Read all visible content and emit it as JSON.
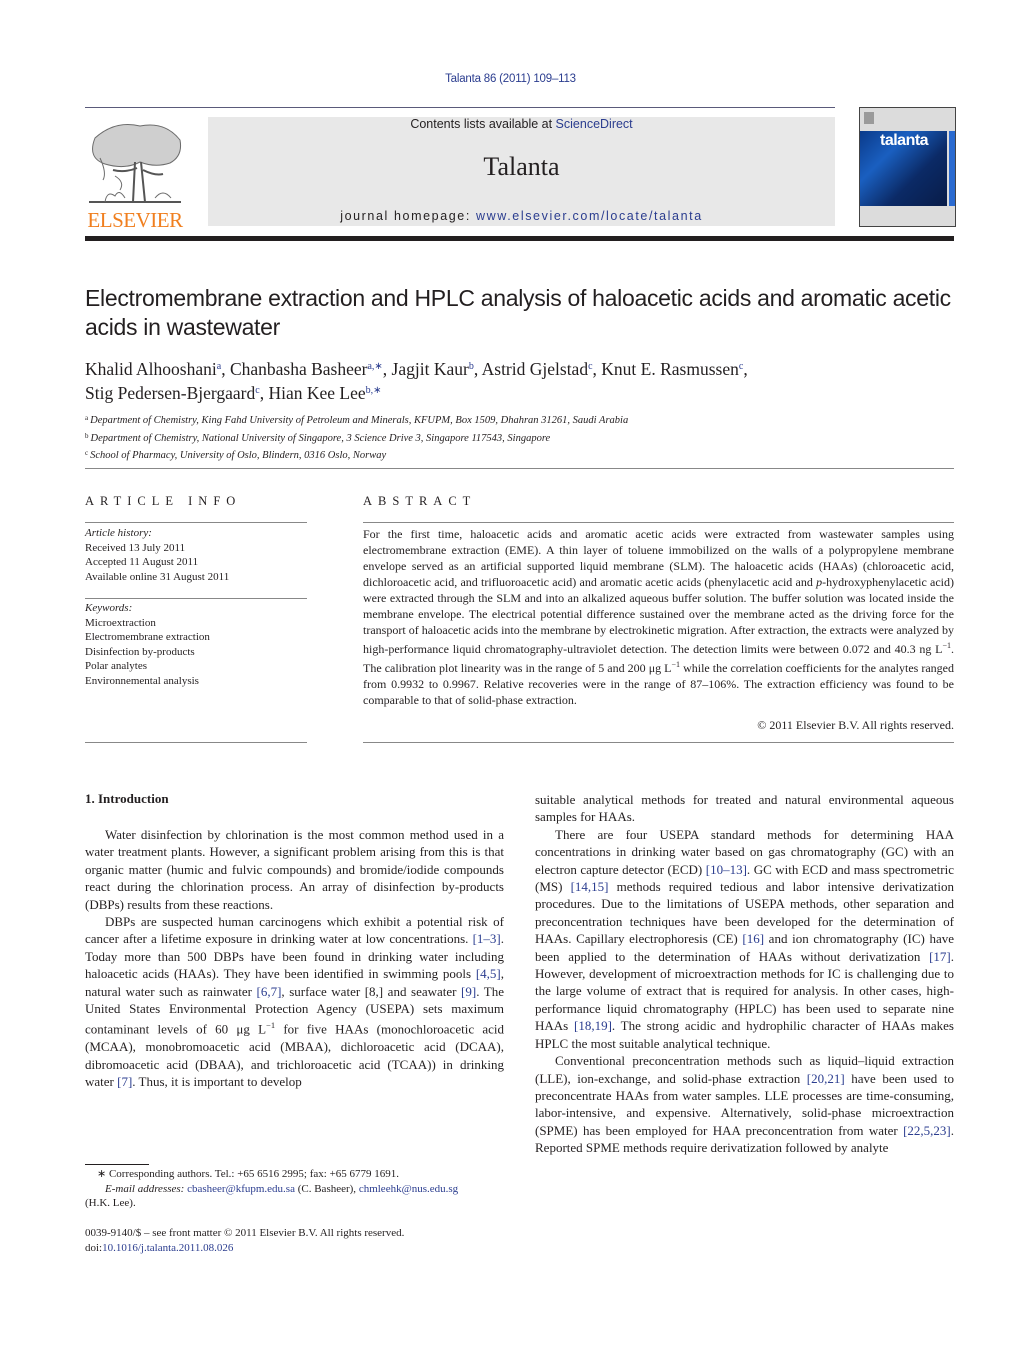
{
  "header": {
    "journal_ref": "Talanta 86 (2011) 109–113",
    "contents_prefix": "Contents lists available at ",
    "contents_link": "ScienceDirect",
    "journal_name": "Talanta",
    "homepage_prefix": "journal homepage: ",
    "homepage_link": "www.elsevier.com/locate/talanta",
    "publisher_logo": "ELSEVIER",
    "cover_title": "talanta",
    "colors": {
      "link": "#2b3d8f",
      "elsevier_orange": "#f07f1f",
      "masthead_bg": "#e8e8e8"
    }
  },
  "article": {
    "title": "Electromembrane extraction and HPLC analysis of haloacetic acids and aromatic acetic acids in wastewater",
    "authors": [
      {
        "name": "Khalid Alhooshani",
        "sup": "a"
      },
      {
        "name": "Chanbasha Basheer",
        "sup": "a,∗"
      },
      {
        "name": "Jagjit Kaur",
        "sup": "b"
      },
      {
        "name": "Astrid Gjelstad",
        "sup": "c"
      },
      {
        "name": "Knut E. Rasmussen",
        "sup": "c"
      },
      {
        "name": "Stig Pedersen-Bjergaard",
        "sup": "c"
      },
      {
        "name": "Hian Kee Lee",
        "sup": "b,∗"
      }
    ],
    "affiliations": [
      {
        "key": "a",
        "text": "Department of Chemistry, King Fahd University of Petroleum and Minerals, KFUPM, Box 1509, Dhahran 31261, Saudi Arabia"
      },
      {
        "key": "b",
        "text": "Department of Chemistry, National University of Singapore, 3 Science Drive 3, Singapore 117543, Singapore"
      },
      {
        "key": "c",
        "text": "School of Pharmacy, University of Oslo, Blindern, 0316 Oslo, Norway"
      }
    ]
  },
  "article_info": {
    "heading": "ARTICLE INFO",
    "history_label": "Article history:",
    "history": [
      "Received 13 July 2011",
      "Accepted 11 August 2011",
      "Available online 31 August 2011"
    ],
    "keywords_label": "Keywords:",
    "keywords": [
      "Microextraction",
      "Electromembrane extraction",
      "Disinfection by-products",
      "Polar analytes",
      "Environnemental analysis"
    ]
  },
  "abstract": {
    "heading": "ABSTRACT",
    "text_1": "For the first time, haloacetic acids and aromatic acetic acids were extracted from wastewater samples using electromembrane extraction (EME). A thin layer of toluene immobilized on the walls of a polypropylene membrane envelope served as an artificial supported liquid membrane (SLM). The haloacetic acids (HAAs) (chloroacetic acid, dichloroacetic acid, and trifluoroacetic acid) and aromatic acetic acids (phenylacetic acid and ",
    "text_p": "p",
    "text_2": "-hydroxyphenylacetic acid) were extracted through the SLM and into an alkalized aqueous buffer solution. The buffer solution was located inside the membrane envelope. The electrical potential difference sustained over the membrane acted as the driving force for the transport of haloacetic acids into the membrane by electrokinetic migration. After extraction, the extracts were analyzed by high-performance liquid chromatography-ultraviolet detection. The detection limits were between 0.072 and 40.3 ng L",
    "text_3": ". The calibration plot linearity was in the range of 5 and 200 μg L",
    "text_4": " while the correlation coefficients for the analytes ranged from 0.9932 to 0.9967. Relative recoveries were in the range of 87–106%. The extraction efficiency was found to be comparable to that of solid-phase extraction.",
    "sup_minus1": "−1",
    "copyright": "© 2011 Elsevier B.V. All rights reserved."
  },
  "body": {
    "section_heading": "1.  Introduction",
    "p1": "Water disinfection by chlorination is the most common method used in a water treatment plants. However, a significant problem arising from this is that organic matter (humic and fulvic compounds) and bromide/iodide compounds react during the chlorination process. An array of disinfection by-products (DBPs) results from these reactions.",
    "p2": {
      "a": "DBPs are suspected human carcinogens which exhibit a potential risk of cancer after a lifetime exposure in drinking water at low concentrations. ",
      "ref1": "[1–3]",
      "b": ". Today more than 500 DBPs have been found in drinking water including haloacetic acids (HAAs). They have been identified in swimming pools ",
      "ref2": "[4,5]",
      "c": ", natural water such as rainwater ",
      "ref3": "[6,7]",
      "d": ", surface water [8,] and seawater ",
      "ref4": "[9]",
      "e": ". The United States Environmental Protection Agency (USEPA) sets maximum contaminant levels of 60 μg L",
      "sup": "−1",
      "f": " for five HAAs (monochloroacetic acid (MCAA), monobromoacetic acid (MBAA), dichloroacetic acid (DCAA), dibromoacetic acid (DBAA), and trichloroacetic acid (TCAA)) in drinking water ",
      "ref5": "[7]",
      "g": ". Thus, it is important to develop"
    },
    "r0": "suitable analytical methods for treated and natural environmental aqueous samples for HAAs.",
    "p3": {
      "a": "There are four USEPA standard methods for determining HAA concentrations in drinking water based on gas chromatography (GC) with an electron capture detector (ECD) ",
      "ref1": "[10–13]",
      "b": ". GC with ECD and mass spectrometric (MS) ",
      "ref2": "[14,15]",
      "c": " methods required tedious and labor intensive derivatization procedures. Due to the limitations of USEPA methods, other separation and preconcentration techniques have been developed for the determination of HAAs. Capillary electrophoresis (CE) ",
      "ref3": "[16]",
      "d": " and ion chromatography (IC) have been applied to the determination of HAAs without derivatization ",
      "ref4": "[17]",
      "e": ". However, development of microextraction methods for IC is challenging due to the large volume of extract that is required for analysis. In other cases, high-performance liquid chromatography (HPLC) has been used to separate nine HAAs ",
      "ref5": "[18,19]",
      "f": ". The strong acidic and hydrophilic character of HAAs makes HPLC the most suitable analytical technique."
    },
    "p4": {
      "a": "Conventional preconcentration methods such as liquid–liquid extraction (LLE), ion-exchange, and solid-phase extraction ",
      "ref1": "[20,21]",
      "b": " have been used to preconcentrate HAAs from water samples. LLE processes are time-consuming, labor-intensive, and expensive. Alternatively, solid-phase microextraction (SPME) has been employed for HAA preconcentration from water ",
      "ref2": "[22,5,23]",
      "c": ". Reported SPME methods require derivatization followed by analyte"
    }
  },
  "footnotes": {
    "corresponding": "∗ Corresponding authors. Tel.: +65 6516 2995; fax: +65 6779 1691.",
    "email_label": "E-mail addresses: ",
    "email1": "cbasheer@kfupm.edu.sa",
    "email1_name": " (C. Basheer), ",
    "email2": "chmleehk@nus.edu.sg",
    "email2_name": "(H.K. Lee).",
    "issn": "0039-9140/$ – see front matter © 2011 Elsevier B.V. All rights reserved.",
    "doi_prefix": "doi:",
    "doi": "10.1016/j.talanta.2011.08.026"
  }
}
